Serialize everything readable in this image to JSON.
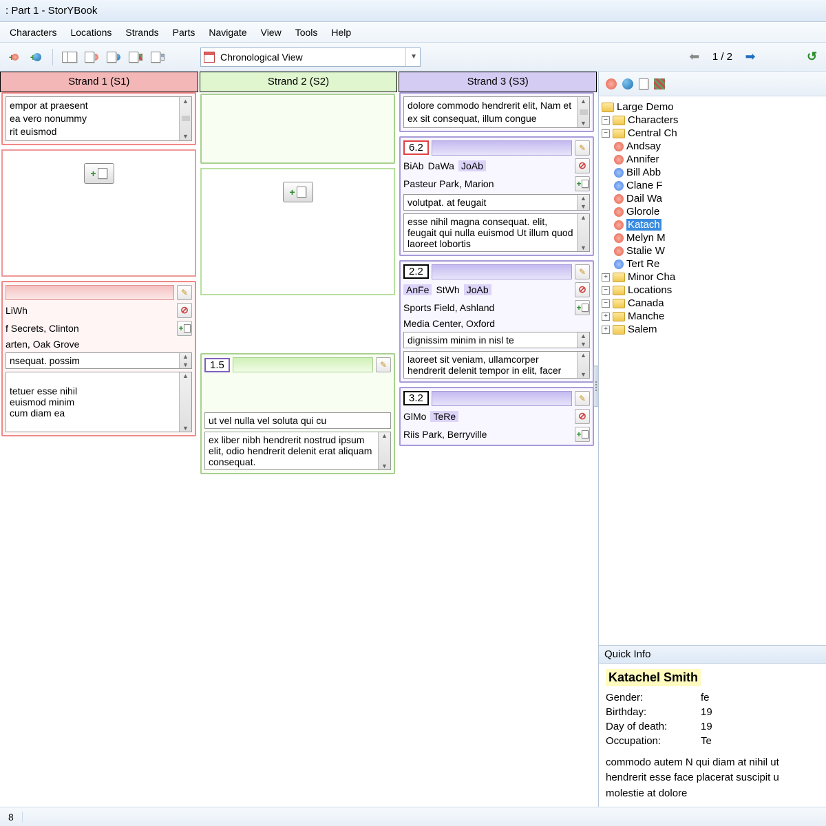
{
  "window": {
    "title": ": Part 1 - StorYBook"
  },
  "menu": [
    "Characters",
    "Locations",
    "Strands",
    "Parts",
    "Navigate",
    "View",
    "Tools",
    "Help"
  ],
  "view_selector": {
    "label": "Chronological View"
  },
  "pager": {
    "label": "1 / 2"
  },
  "strands": [
    {
      "id": "s1",
      "header": "Strand 1 (S1)"
    },
    {
      "id": "s2",
      "header": "Strand 2 (S2)"
    },
    {
      "id": "s3",
      "header": "Strand 3 (S3)"
    }
  ],
  "col1": {
    "card_top_text": "empor at praesent\nea vero nonummy\nrit euismod",
    "card3": {
      "chars": "LiWh",
      "loc1": "f Secrets, Clinton",
      "loc2": "arten, Oak Grove",
      "t1": "nsequat. possim",
      "t2": "tetuer esse nihil\neuismod minim\ncum diam ea"
    }
  },
  "col2": {
    "card3": {
      "num": "1.5",
      "t1": "ut vel nulla vel soluta qui cu",
      "t2": "ex liber nibh hendrerit nostrud ipsum elit, odio hendrerit delenit erat aliquam consequat."
    }
  },
  "col3": {
    "card_top_text": "dolore commodo hendrerit elit, Nam et ex sit consequat, illum congue",
    "card2": {
      "num": "6.2",
      "chars": [
        "BiAb",
        "DaWa",
        "JoAb"
      ],
      "loc": "Pasteur Park, Marion",
      "t1": "volutpat. at feugait",
      "t2": "esse nihil magna consequat. elit, feugait qui nulla euismod Ut illum quod laoreet lobortis"
    },
    "card3": {
      "num": "2.2",
      "chars": [
        "AnFe",
        "StWh",
        "JoAb"
      ],
      "loc1": "Sports Field, Ashland",
      "loc2": "Media Center, Oxford",
      "t1": "dignissim minim in nisl te",
      "t2": "laoreet sit veniam, ullamcorper hendrerit delenit tempor in elit, facer"
    },
    "card4": {
      "num": "3.2",
      "chars": [
        "GlMo",
        "TeRe"
      ],
      "loc": "Riis Park, Berryville"
    }
  },
  "tree": {
    "root": "Large Demo",
    "characters_label": "Characters",
    "central_label": "Central Ch",
    "central": [
      {
        "name": "Andsay",
        "g": "f"
      },
      {
        "name": "Annifer",
        "g": "f"
      },
      {
        "name": "Bill Abb",
        "g": "m"
      },
      {
        "name": "Clane F",
        "g": "m"
      },
      {
        "name": "Dail Wa",
        "g": "f"
      },
      {
        "name": "Glorole",
        "g": "f"
      },
      {
        "name": "Katach",
        "g": "f",
        "selected": true
      },
      {
        "name": "Melyn M",
        "g": "f"
      },
      {
        "name": "Stalie W",
        "g": "f"
      },
      {
        "name": "Tert Re",
        "g": "m"
      }
    ],
    "minor_label": "Minor Cha",
    "locations_label": "Locations",
    "locations": [
      {
        "name": "Canada",
        "expanded": true
      },
      {
        "name": "Manche",
        "expanded": false,
        "indent": 1
      },
      {
        "name": "Salem",
        "expanded": false,
        "indent": 1
      }
    ]
  },
  "quickinfo": {
    "header": "Quick Info",
    "name": "Katachel Smith",
    "rows": [
      {
        "label": "Gender:",
        "value": "fe"
      },
      {
        "label": "Birthday:",
        "value": "19"
      },
      {
        "label": "Day of death:",
        "value": "19"
      },
      {
        "label": "Occupation:",
        "value": "Te"
      }
    ],
    "text": "commodo autem N qui diam at nihil ut hendrerit esse face placerat suscipit u molestie at dolore"
  },
  "status": {
    "left": "8"
  }
}
